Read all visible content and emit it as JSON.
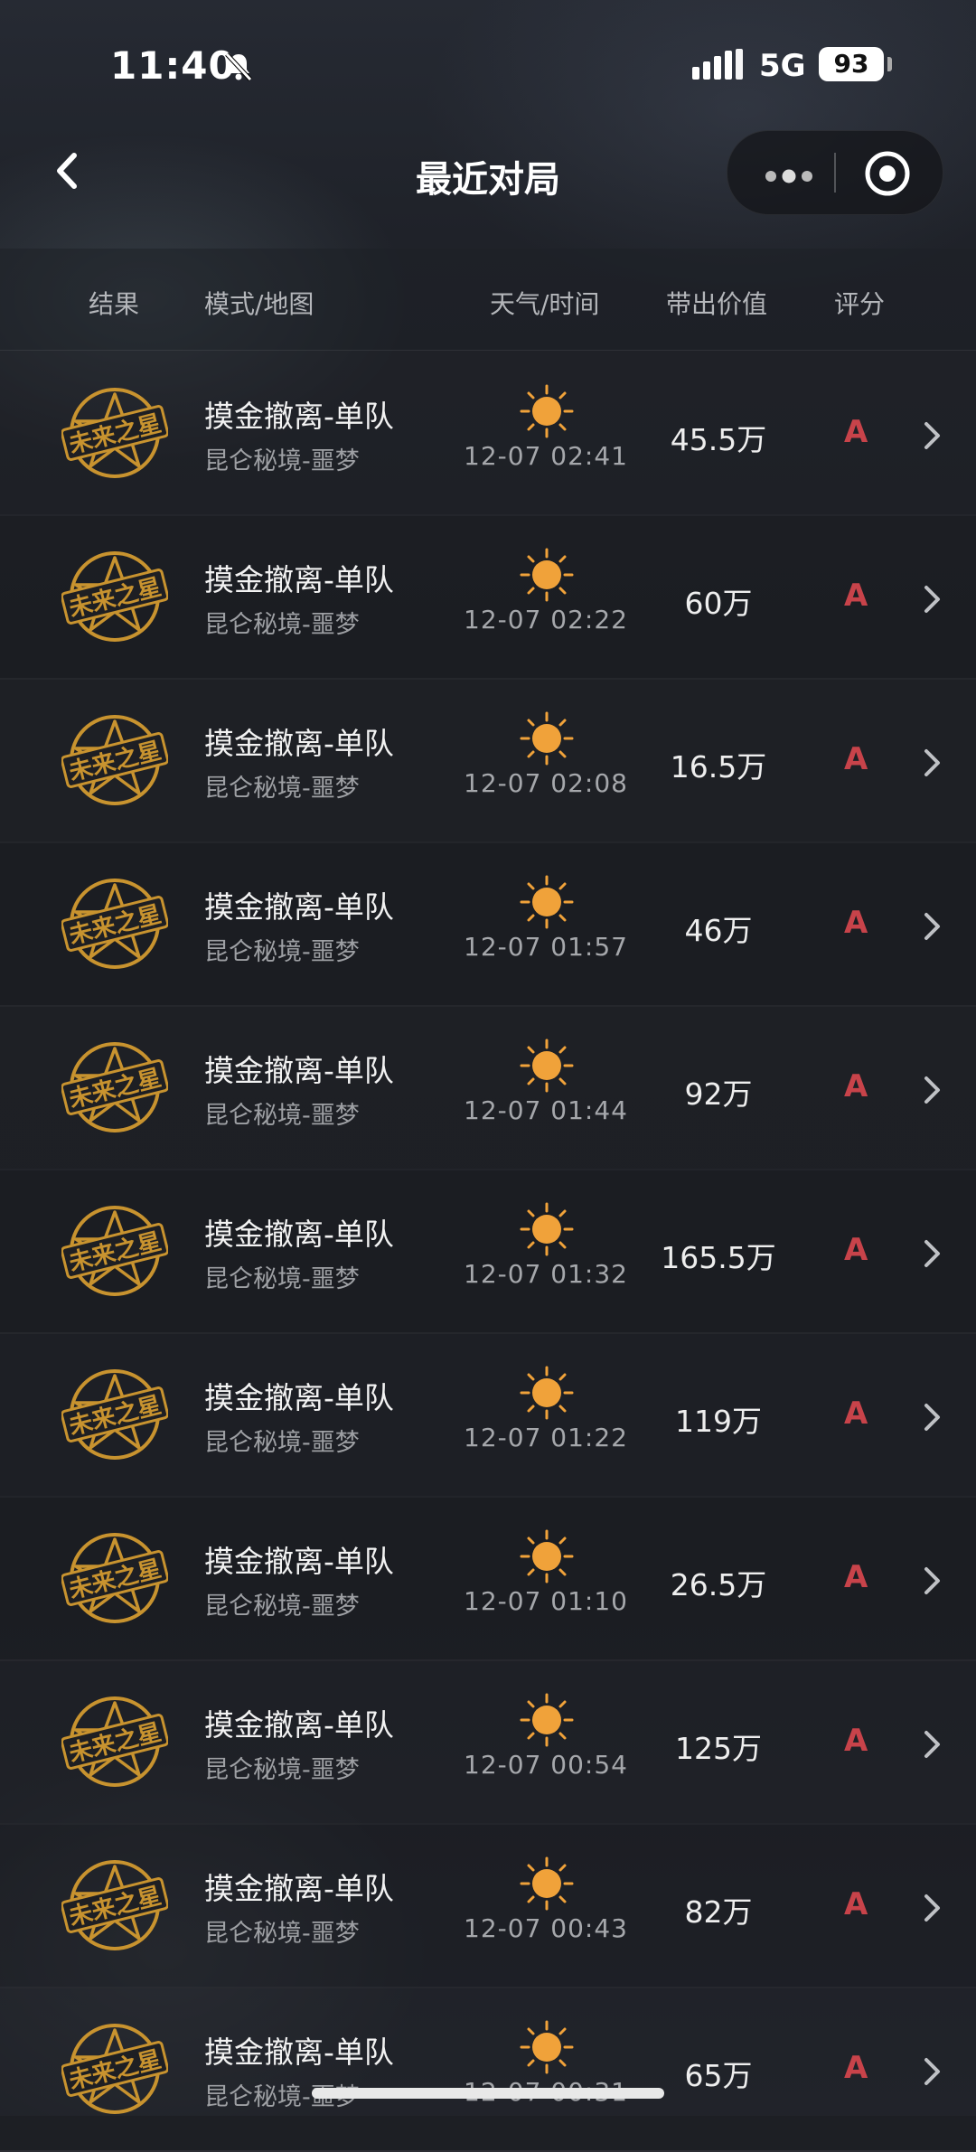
{
  "status_bar": {
    "time": "11:40",
    "network": "5G",
    "battery": "93"
  },
  "nav": {
    "title": "最近对局"
  },
  "table": {
    "headers": [
      "结果",
      "模式/地图",
      "天气/时间",
      "带出价值",
      "评分"
    ],
    "rows": [
      {
        "badge": "未来之星",
        "mode": "摸金撤离-单队",
        "map": "昆仑秘境-噩梦",
        "datetime": "12-07 02:41",
        "value": "45.5万",
        "grade": "A"
      },
      {
        "badge": "未来之星",
        "mode": "摸金撤离-单队",
        "map": "昆仑秘境-噩梦",
        "datetime": "12-07 02:22",
        "value": "60万",
        "grade": "A"
      },
      {
        "badge": "未来之星",
        "mode": "摸金撤离-单队",
        "map": "昆仑秘境-噩梦",
        "datetime": "12-07 02:08",
        "value": "16.5万",
        "grade": "A"
      },
      {
        "badge": "未来之星",
        "mode": "摸金撤离-单队",
        "map": "昆仑秘境-噩梦",
        "datetime": "12-07 01:57",
        "value": "46万",
        "grade": "A"
      },
      {
        "badge": "未来之星",
        "mode": "摸金撤离-单队",
        "map": "昆仑秘境-噩梦",
        "datetime": "12-07 01:44",
        "value": "92万",
        "grade": "A"
      },
      {
        "badge": "未来之星",
        "mode": "摸金撤离-单队",
        "map": "昆仑秘境-噩梦",
        "datetime": "12-07 01:32",
        "value": "165.5万",
        "grade": "A"
      },
      {
        "badge": "未来之星",
        "mode": "摸金撤离-单队",
        "map": "昆仑秘境-噩梦",
        "datetime": "12-07 01:22",
        "value": "119万",
        "grade": "A"
      },
      {
        "badge": "未来之星",
        "mode": "摸金撤离-单队",
        "map": "昆仑秘境-噩梦",
        "datetime": "12-07 01:10",
        "value": "26.5万",
        "grade": "A"
      },
      {
        "badge": "未来之星",
        "mode": "摸金撤离-单队",
        "map": "昆仑秘境-噩梦",
        "datetime": "12-07 00:54",
        "value": "125万",
        "grade": "A"
      },
      {
        "badge": "未来之星",
        "mode": "摸金撤离-单队",
        "map": "昆仑秘境-噩梦",
        "datetime": "12-07 00:43",
        "value": "82万",
        "grade": "A"
      },
      {
        "badge": "未来之星",
        "mode": "摸金撤离-单队",
        "map": "昆仑秘境-噩梦",
        "datetime": "12-07 00:31",
        "value": "65万",
        "grade": "A"
      }
    ]
  },
  "colors": {
    "badge_gold": "#c8932f",
    "sun_orange": "#f0a23a",
    "grade_red": "#c8434a"
  },
  "icons": {
    "weather": "sun-icon",
    "row_action": "chevron-right-icon",
    "back": "back-arrow-icon"
  }
}
